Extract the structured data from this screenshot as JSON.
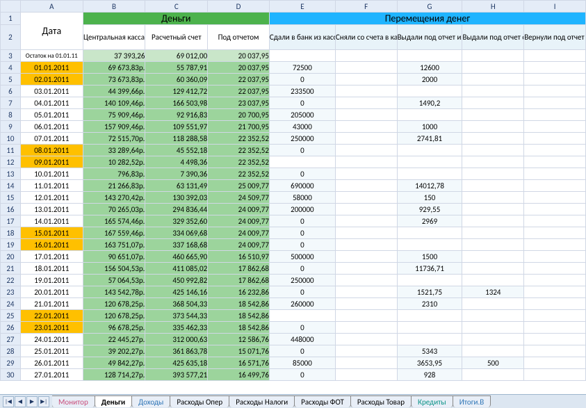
{
  "columns": [
    "",
    "A",
    "B",
    "C",
    "D",
    "E",
    "F",
    "G",
    "H",
    "I"
  ],
  "headers": {
    "dengi": "Деньги",
    "perem": "Перемещения денег",
    "date": "Дата",
    "b": "Центральная касса",
    "c": "Расчетный счет",
    "d": "Под отчетом",
    "e": "Сдали в банк из кассы",
    "f": "Сняли со счета в кассу",
    "g": "Выдали под отчет из кассы",
    "h": "Выдали под отчет со счета",
    "i": "Вернули под отчет в кассу"
  },
  "remainder": {
    "label": "Остаток на 01.01.11",
    "b": "37 393,26",
    "c": "69 012,00",
    "d": "20 037,95"
  },
  "rows": [
    {
      "n": 4,
      "hl": true,
      "a": "01.01.2011",
      "b": "69 673,83р.",
      "c": "55 787,91",
      "d": "20 037,95",
      "e": "72500",
      "f": "",
      "g": "12600",
      "h": "",
      "i": ""
    },
    {
      "n": 5,
      "hl": true,
      "a": "02.01.2011",
      "b": "73 673,83р.",
      "c": "60 360,09",
      "d": "22 037,95",
      "e": "0",
      "f": "",
      "g": "2000",
      "h": "",
      "i": ""
    },
    {
      "n": 6,
      "hl": false,
      "a": "03.01.2011",
      "b": "44 399,66р.",
      "c": "129 412,72",
      "d": "22 037,95",
      "e": "233500",
      "f": "",
      "g": "",
      "h": "",
      "i": ""
    },
    {
      "n": 7,
      "hl": false,
      "a": "04.01.2011",
      "b": "140 109,46р.",
      "c": "166 503,98",
      "d": "23 037,95",
      "e": "0",
      "f": "",
      "g": "1490,2",
      "h": "",
      "i": ""
    },
    {
      "n": 8,
      "hl": false,
      "a": "05.01.2011",
      "b": "75 909,46р.",
      "c": "92 916,83",
      "d": "20 700,95",
      "e": "205000",
      "f": "",
      "g": "",
      "h": "",
      "i": ""
    },
    {
      "n": 9,
      "hl": false,
      "a": "06.01.2011",
      "b": "157 909,46р.",
      "c": "109 551,97",
      "d": "21 700,95",
      "e": "43000",
      "f": "",
      "g": "1000",
      "h": "",
      "i": ""
    },
    {
      "n": 10,
      "hl": false,
      "a": "07.01.2011",
      "b": "72 515,70р.",
      "c": "118 288,58",
      "d": "22 352,52",
      "e": "250000",
      "f": "",
      "g": "2741,81",
      "h": "",
      "i": ""
    },
    {
      "n": 11,
      "hl": true,
      "a": "08.01.2011",
      "b": "33 289,64р.",
      "c": "45 552,18",
      "d": "22 352,52",
      "e": "0",
      "f": "",
      "g": "",
      "h": "",
      "i": ""
    },
    {
      "n": 12,
      "hl": true,
      "a": "09.01.2011",
      "b": "10 282,52р.",
      "c": "4 498,36",
      "d": "22 352,52",
      "e": "",
      "f": "",
      "g": "",
      "h": "",
      "i": ""
    },
    {
      "n": 13,
      "hl": false,
      "a": "10.01.2011",
      "b": "796,83р.",
      "c": "7 390,36",
      "d": "22 352,52",
      "e": "0",
      "f": "",
      "g": "",
      "h": "",
      "i": ""
    },
    {
      "n": 14,
      "hl": false,
      "a": "11.01.2011",
      "b": "21 266,83р.",
      "c": "63 131,49",
      "d": "25 009,77",
      "e": "690000",
      "f": "",
      "g": "14012,78",
      "h": "",
      "i": ""
    },
    {
      "n": 15,
      "hl": false,
      "a": "12.01.2011",
      "b": "143 270,42р.",
      "c": "130 392,03",
      "d": "24 509,77",
      "e": "58000",
      "f": "",
      "g": "150",
      "h": "",
      "i": ""
    },
    {
      "n": 16,
      "hl": false,
      "a": "13.01.2011",
      "b": "70 265,03р.",
      "c": "294 836,44",
      "d": "24 009,77",
      "e": "200000",
      "f": "",
      "g": "929,55",
      "h": "",
      "i": ""
    },
    {
      "n": 17,
      "hl": false,
      "a": "14.01.2011",
      "b": "165 574,46р.",
      "c": "329 352,60",
      "d": "24 009,77",
      "e": "0",
      "f": "",
      "g": "2969",
      "h": "",
      "i": ""
    },
    {
      "n": 18,
      "hl": true,
      "a": "15.01.2011",
      "b": "167 559,46р.",
      "c": "334 069,68",
      "d": "24 009,77",
      "e": "0",
      "f": "",
      "g": "",
      "h": "",
      "i": ""
    },
    {
      "n": 19,
      "hl": true,
      "a": "16.01.2011",
      "b": "163 751,07р.",
      "c": "337 168,68",
      "d": "24 009,77",
      "e": "0",
      "f": "",
      "g": "",
      "h": "",
      "i": ""
    },
    {
      "n": 20,
      "hl": false,
      "a": "17.01.2011",
      "b": "90 651,07р.",
      "c": "460 665,90",
      "d": "16 510,97",
      "e": "500000",
      "f": "",
      "g": "1500",
      "h": "",
      "i": ""
    },
    {
      "n": 21,
      "hl": false,
      "a": "18.01.2011",
      "b": "156 504,53р.",
      "c": "411 085,02",
      "d": "17 862,68",
      "e": "0",
      "f": "",
      "g": "11736,71",
      "h": "",
      "i": ""
    },
    {
      "n": 22,
      "hl": false,
      "a": "19.01.2011",
      "b": "57 064,53р.",
      "c": "450 992,82",
      "d": "17 862,68",
      "e": "250000",
      "f": "",
      "g": "",
      "h": "",
      "i": ""
    },
    {
      "n": 23,
      "hl": false,
      "a": "20.01.2011",
      "b": "143 542,78р.",
      "c": "425 146,16",
      "d": "16 232,86",
      "e": "0",
      "f": "",
      "g": "1521,75",
      "h": "1324",
      "i": ""
    },
    {
      "n": 24,
      "hl": false,
      "a": "21.01.2011",
      "b": "120 678,25р.",
      "c": "368 504,33",
      "d": "18 542,86",
      "e": "260000",
      "f": "",
      "g": "2310",
      "h": "",
      "i": ""
    },
    {
      "n": 25,
      "hl": true,
      "a": "22.01.2011",
      "b": "120 678,25р.",
      "c": "373 544,33",
      "d": "18 542,86",
      "e": "",
      "f": "",
      "g": "",
      "h": "",
      "i": ""
    },
    {
      "n": 26,
      "hl": true,
      "a": "23.01.2011",
      "b": "96 678,25р.",
      "c": "335 462,33",
      "d": "18 542,86",
      "e": "0",
      "f": "",
      "g": "",
      "h": "",
      "i": ""
    },
    {
      "n": 27,
      "hl": false,
      "a": "24.01.2011",
      "b": "22 445,27р.",
      "c": "312 000,63",
      "d": "12 586,76",
      "e": "448000",
      "f": "",
      "g": "",
      "h": "",
      "i": ""
    },
    {
      "n": 28,
      "hl": false,
      "a": "25.01.2011",
      "b": "39 202,27р.",
      "c": "361 863,78",
      "d": "15 071,76",
      "e": "0",
      "f": "",
      "g": "5343",
      "h": "",
      "i": ""
    },
    {
      "n": 29,
      "hl": false,
      "a": "26.01.2011",
      "b": "49 842,27р.",
      "c": "425 635,18",
      "d": "16 571,76",
      "e": "85000",
      "f": "",
      "g": "3653,95",
      "h": "500",
      "i": ""
    },
    {
      "n": 30,
      "hl": false,
      "a": "27.01.2011",
      "b": "128 714,27р.",
      "c": "393 577,21",
      "d": "16 499,76",
      "e": "0",
      "f": "",
      "g": "928",
      "h": "",
      "i": ""
    }
  ],
  "tabs": [
    {
      "label": "Монитор",
      "cls": "pink"
    },
    {
      "label": "Деньги",
      "cls": "active"
    },
    {
      "label": "Доходы",
      "cls": "blue"
    },
    {
      "label": "Расходы Опер",
      "cls": ""
    },
    {
      "label": "Расходы Налоги",
      "cls": ""
    },
    {
      "label": "Расходы ФОТ",
      "cls": ""
    },
    {
      "label": "Расходы Товар",
      "cls": ""
    },
    {
      "label": "Кредиты",
      "cls": "teal"
    },
    {
      "label": "Итоги.В",
      "cls": "blue"
    }
  ],
  "nav": [
    "|◀",
    "◀",
    "▶",
    "▶|"
  ]
}
